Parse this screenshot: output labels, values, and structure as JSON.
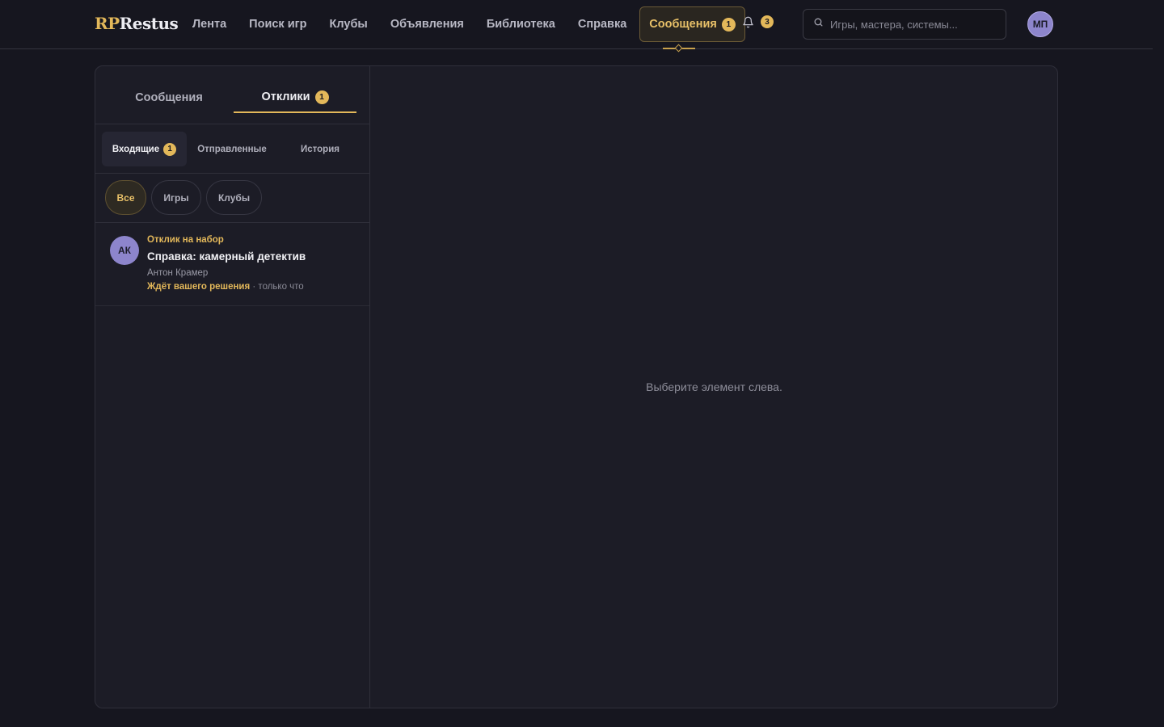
{
  "header": {
    "logo_accent": "RP",
    "logo_rest": "Restus",
    "nav": [
      {
        "label": "Лента"
      },
      {
        "label": "Поиск игр"
      },
      {
        "label": "Клубы"
      },
      {
        "label": "Объявления"
      },
      {
        "label": "Библиотека"
      },
      {
        "label": "Справка"
      }
    ],
    "messages": {
      "label": "Сообщения",
      "count": "1"
    },
    "notifications": {
      "icon": "bell-icon",
      "count": "3"
    },
    "search": {
      "placeholder": "Игры, мастера, системы..."
    },
    "user": {
      "initials": "МП"
    }
  },
  "tabs": {
    "messages_label": "Сообщения",
    "responses_label": "Отклики",
    "responses_count": "1"
  },
  "subtabs": {
    "incoming_label": "Входящие",
    "incoming_count": "1",
    "sent_label": "Отправленные",
    "history_label": "История"
  },
  "filters": {
    "all": "Все",
    "games": "Игры",
    "clubs": "Клубы"
  },
  "items": [
    {
      "initials": "АК",
      "type": "Отклик на набор",
      "title": "Справка: камерный детектив",
      "author": "Антон Крамер",
      "status": "Ждёт вашего решения",
      "time": "· только что"
    }
  ],
  "detail": {
    "empty_text": "Выберите элемент слева."
  },
  "colors": {
    "accent": "#e3b85a",
    "background": "#16161f",
    "panel": "#1c1c26",
    "avatar": "#8d85cc"
  }
}
